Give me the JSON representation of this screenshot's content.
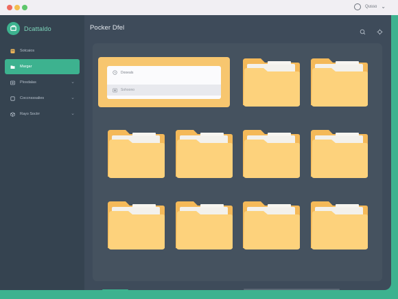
{
  "window": {
    "app_name": "Dcattaldo",
    "page_title": "Pocker Dfel",
    "titlebar_text": "Qusso"
  },
  "sidebar": {
    "items": [
      {
        "label": "Sotcaios",
        "icon": "file-icon",
        "active": false,
        "has_chevron": false
      },
      {
        "label": "Margar",
        "icon": "folder-icon",
        "active": true,
        "has_chevron": false
      },
      {
        "label": "Plosdalas",
        "icon": "image-icon",
        "active": false,
        "has_chevron": true
      },
      {
        "label": "Coccnsssalies",
        "icon": "square-icon",
        "active": false,
        "has_chevron": true
      },
      {
        "label": "Rayo Soctrr",
        "icon": "cube-icon",
        "active": false,
        "has_chevron": true
      }
    ]
  },
  "main": {
    "card": {
      "row1": "Dooeals",
      "row2": "Sohoono"
    },
    "folders": [
      {
        "name": "folder-1",
        "row": 0,
        "col": 2
      },
      {
        "name": "folder-2",
        "row": 0,
        "col": 3
      },
      {
        "name": "folder-3",
        "row": 1,
        "col": 0
      },
      {
        "name": "folder-4",
        "row": 1,
        "col": 1
      },
      {
        "name": "folder-5",
        "row": 1,
        "col": 2
      },
      {
        "name": "folder-6",
        "row": 1,
        "col": 3
      },
      {
        "name": "folder-7",
        "row": 2,
        "col": 0
      },
      {
        "name": "folder-8",
        "row": 2,
        "col": 1
      },
      {
        "name": "folder-9",
        "row": 2,
        "col": 2
      },
      {
        "name": "folder-10",
        "row": 2,
        "col": 3
      }
    ]
  },
  "colors": {
    "accent": "#3db28f",
    "sidebar_bg": "#354350",
    "window_bg": "#3e4b5a",
    "folder_back": "#f4b959",
    "folder_front": "#fdd27c",
    "card_bg": "#f7c66f"
  }
}
